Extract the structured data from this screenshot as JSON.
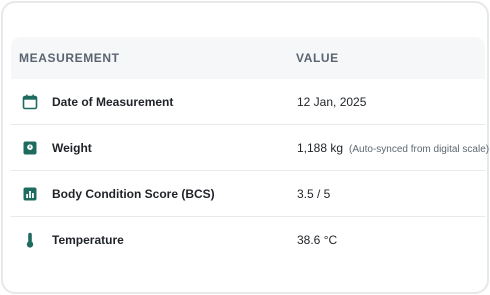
{
  "table": {
    "headers": {
      "measurement": "MEASUREMENT",
      "value": "VALUE"
    },
    "rows": [
      {
        "icon": "calendar-icon",
        "label": "Date of Measurement",
        "value": "12 Jan, 2025",
        "note": ""
      },
      {
        "icon": "scale-icon",
        "label": "Weight",
        "value": "1,188 kg",
        "note": "(Auto-synced from digital scale)"
      },
      {
        "icon": "bar-chart-icon",
        "label": "Body Condition Score (BCS)",
        "value": "3.5 / 5",
        "note": ""
      },
      {
        "icon": "thermometer-icon",
        "label": "Temperature",
        "value": "38.6 °C",
        "note": ""
      }
    ]
  },
  "colors": {
    "accent": "#1f6b60",
    "header_bg": "#f6f7f8",
    "border": "#e6e8ea"
  }
}
